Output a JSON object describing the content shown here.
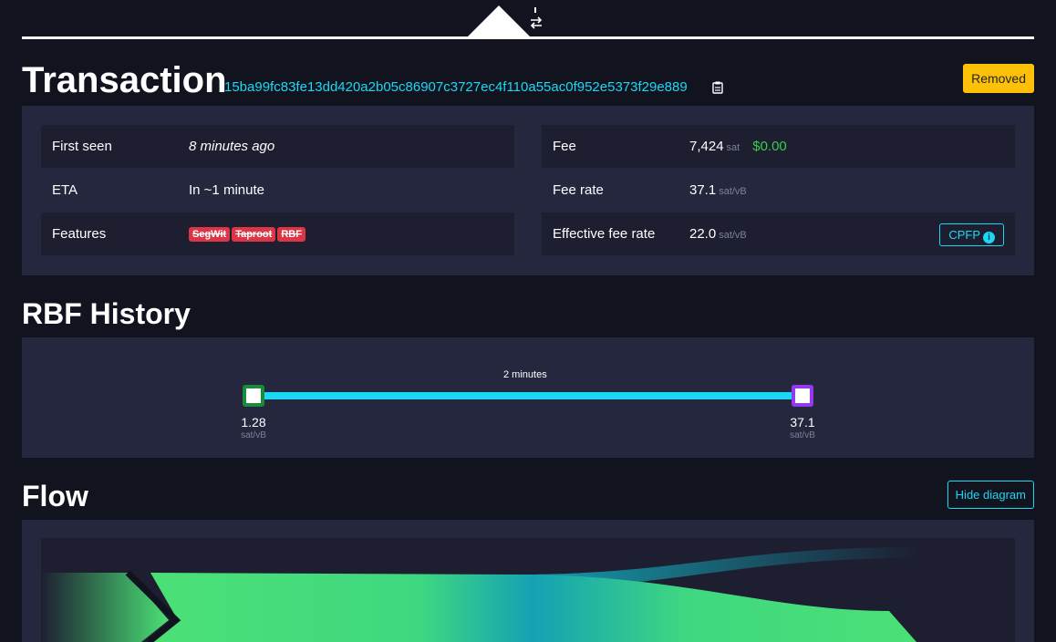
{
  "nav": {
    "swap_icon": "swap-arrows-icon"
  },
  "header": {
    "title": "Transaction",
    "txid": "15ba99fc83fe13dd420a2b05c86907c3727ec4f110a55ac0f952e5373f29e889",
    "status_badge": "Removed"
  },
  "details": {
    "first_seen": {
      "label": "First seen",
      "value": "8 minutes ago"
    },
    "eta": {
      "label": "ETA",
      "value": "In ~1 minute"
    },
    "features": {
      "label": "Features",
      "badges": [
        "SegWit",
        "Taproot",
        "RBF"
      ]
    },
    "fee": {
      "label": "Fee",
      "value": "7,424",
      "unit": "sat",
      "fiat": "$0.00"
    },
    "fee_rate": {
      "label": "Fee rate",
      "value": "37.1",
      "unit": "sat/vB"
    },
    "effective_fee_rate": {
      "label": "Effective fee rate",
      "value": "22.0",
      "unit": "sat/vB",
      "cpfp_label": "CPFP"
    }
  },
  "rbf": {
    "title": "RBF History",
    "duration": "2 minutes",
    "first": {
      "value": "1.28",
      "unit": "sat/vB"
    },
    "last": {
      "value": "37.1",
      "unit": "sat/vB"
    }
  },
  "flow": {
    "title": "Flow",
    "hide_label": "Hide diagram"
  },
  "colors": {
    "accent": "#1bd8f4",
    "removed": "#ffc107",
    "feature_badge": "#dc3545",
    "fiat": "#3bcc49",
    "rbf_first_node": "#1a8a3b",
    "rbf_last_node": "#9339f4"
  }
}
